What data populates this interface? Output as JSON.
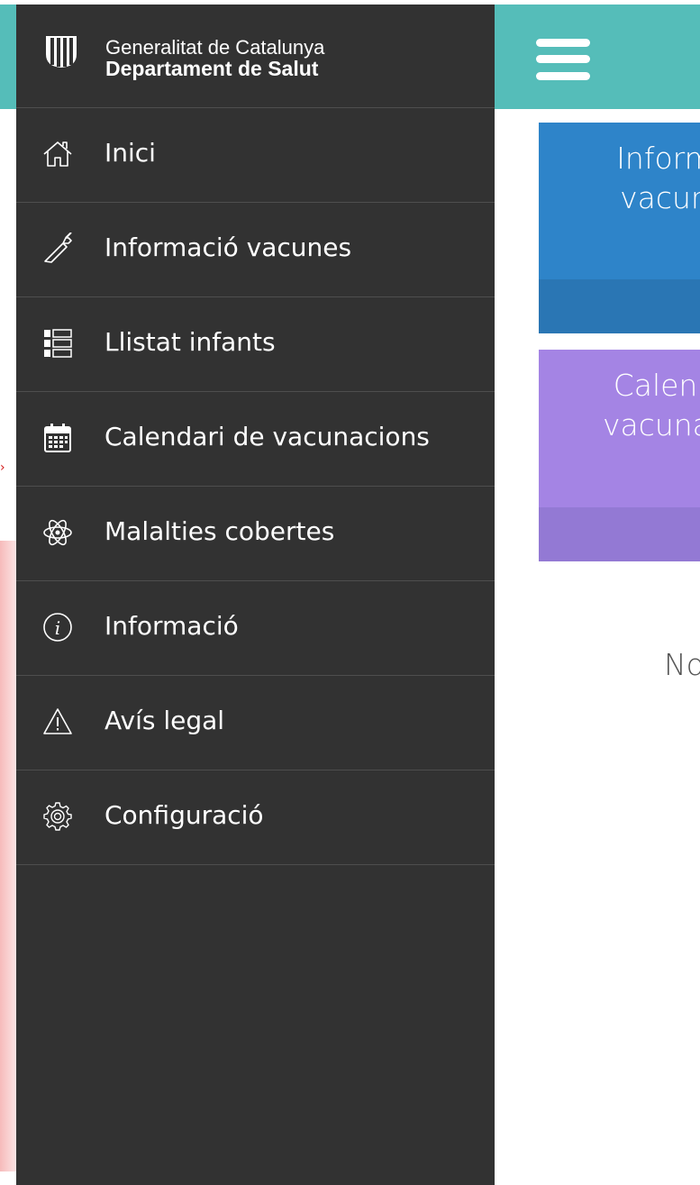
{
  "app": {
    "org_line1": "Generalitat de Catalunya",
    "org_line2": "Departament de Salut"
  },
  "drawer": {
    "items": [
      {
        "label": "Inici",
        "icon": "home-icon"
      },
      {
        "label": "Informació vacunes",
        "icon": "syringe-icon"
      },
      {
        "label": "Llistat infants",
        "icon": "list-icon"
      },
      {
        "label": "Calendari de vacunacions",
        "icon": "calendar-icon"
      },
      {
        "label": "Malalties cobertes",
        "icon": "atom-icon"
      },
      {
        "label": "Informació",
        "icon": "info-icon"
      },
      {
        "label": "Avís legal",
        "icon": "warning-icon"
      },
      {
        "label": "Configuració",
        "icon": "gear-icon"
      }
    ]
  },
  "background": {
    "topbar_color": "#55bdb9",
    "tiles": [
      {
        "text": "Inform\nvacun",
        "color": "#2e84c9"
      },
      {
        "text": "Calend\nvacunac",
        "color": "#a484e4"
      }
    ],
    "note": "No"
  },
  "colors": {
    "drawer_bg": "#323232",
    "divider": "#4e4e4e"
  }
}
